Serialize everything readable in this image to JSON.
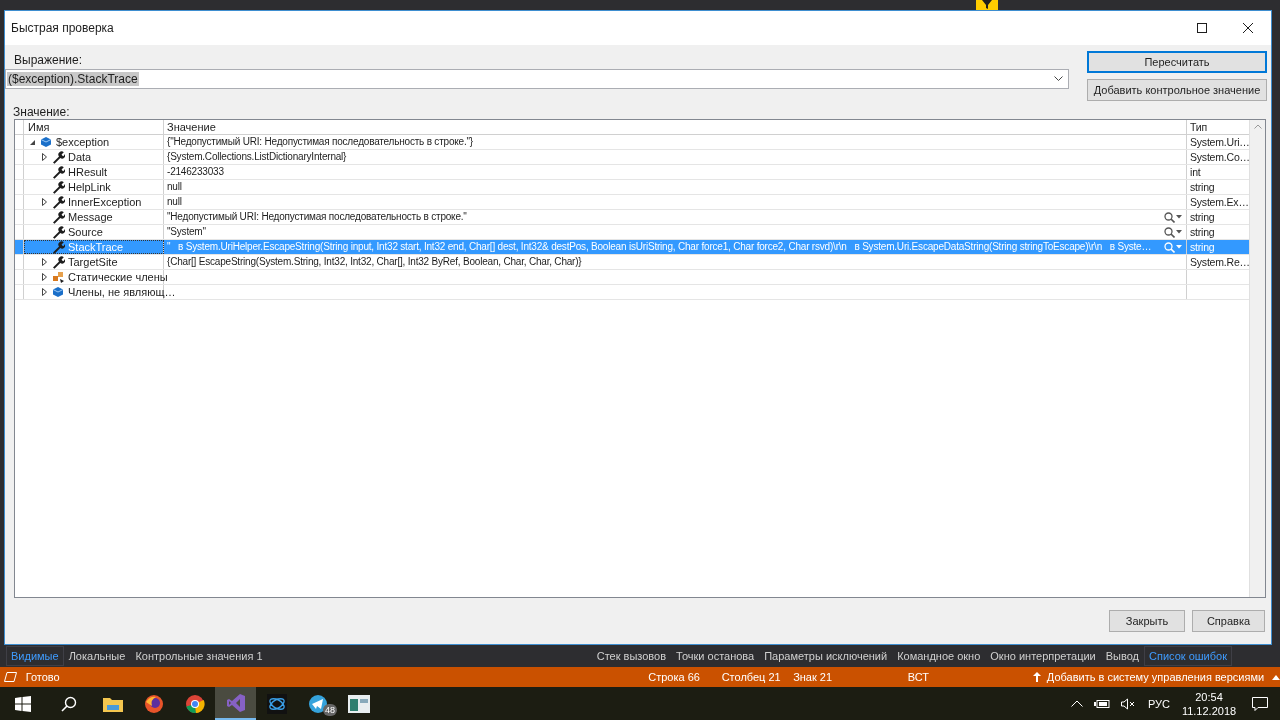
{
  "window": {
    "title": "Быстрая проверка"
  },
  "expression": {
    "label": "Выражение:",
    "value": "($exception).StackTrace"
  },
  "side_buttons": [
    {
      "label": "Пересчитать",
      "default": true
    },
    {
      "label": "Добавить контрольное значение",
      "default": false
    }
  ],
  "value_label": "Значение:",
  "grid": {
    "columns": [
      "Имя",
      "Значение",
      "Тип"
    ],
    "rows": [
      {
        "name": "$exception",
        "value": "{\"Недопустимый URI: Недопустимая последовательность в строке.\"}",
        "type": "System.Uri…",
        "kind": "object",
        "expandable": true,
        "expanded": true,
        "selected": false,
        "children": [
          {
            "name": "Data",
            "value": "{System.Collections.ListDictionaryInternal}",
            "type": "System.Co…",
            "kind": "property",
            "expandable": true,
            "expanded": false,
            "selected": false
          },
          {
            "name": "HResult",
            "value": "-2146233033",
            "type": "int",
            "kind": "property",
            "expandable": false,
            "selected": false
          },
          {
            "name": "HelpLink",
            "value": "null",
            "type": "string",
            "kind": "property",
            "expandable": false,
            "selected": false
          },
          {
            "name": "InnerException",
            "value": "null",
            "type": "System.Ex…",
            "kind": "property",
            "expandable": true,
            "expanded": false,
            "selected": false
          },
          {
            "name": "Message",
            "value": "\"Недопустимый URI: Недопустимая последовательность в строке.\"",
            "type": "string",
            "kind": "property",
            "expandable": false,
            "selected": false,
            "visualizer": true
          },
          {
            "name": "Source",
            "value": "\"System\"",
            "type": "string",
            "kind": "property",
            "expandable": false,
            "selected": false,
            "visualizer": true
          },
          {
            "name": "StackTrace",
            "value": "\"   в System.UriHelper.EscapeString(String input, Int32 start, Int32 end, Char[] dest, Int32& destPos, Boolean isUriString, Char force1, Char force2, Char rsvd)\\r\\n   в System.Uri.EscapeDataString(String stringToEscape)\\r\\n   в Syste…",
            "type": "string",
            "kind": "property",
            "expandable": false,
            "selected": true,
            "visualizer": true
          },
          {
            "name": "TargetSite",
            "value": "{Char[] EscapeString(System.String, Int32, Int32, Char[], Int32 ByRef, Boolean, Char, Char, Char)}",
            "type": "System.Re…",
            "kind": "property",
            "expandable": true,
            "expanded": false,
            "selected": false
          },
          {
            "name": "Статические члены",
            "kind": "static",
            "expandable": true,
            "expanded": false,
            "selected": false
          },
          {
            "name": "Члены, не являющ…",
            "kind": "object",
            "expandable": true,
            "expanded": false,
            "selected": false
          }
        ]
      }
    ]
  },
  "dialog_buttons": [
    "Закрыть",
    "Справка"
  ],
  "tool_tabs_left": [
    {
      "label": "Видимые",
      "selected": true
    },
    {
      "label": "Локальные",
      "selected": false
    },
    {
      "label": "Контрольные значения 1",
      "selected": false
    }
  ],
  "tool_tabs_right": [
    {
      "label": "Стек вызовов",
      "selected": false
    },
    {
      "label": "Точки останова",
      "selected": false
    },
    {
      "label": "Параметры исключений",
      "selected": false
    },
    {
      "label": "Командное окно",
      "selected": false
    },
    {
      "label": "Окно интерпретации",
      "selected": false
    },
    {
      "label": "Вывод",
      "selected": false
    },
    {
      "label": "Список ошибок",
      "selected": true
    }
  ],
  "status_bar": {
    "text": "Готово",
    "line": "Строка 66",
    "column": "Столбец 21",
    "char": "Знак 21",
    "mode": "ВСТ",
    "source_control": "Добавить в систему управления версиями"
  },
  "taskbar": {
    "apps": [
      {
        "kind": "explorer",
        "active": false
      },
      {
        "kind": "firefox",
        "active": false
      },
      {
        "kind": "chrome",
        "active": false
      },
      {
        "kind": "visualstudio",
        "active": true
      },
      {
        "kind": "dark",
        "active": false
      },
      {
        "kind": "telegram",
        "active": false,
        "badge": "48"
      },
      {
        "kind": "window",
        "active": false
      }
    ],
    "language": "РУС",
    "time": "20:54",
    "date": "11.12.2018"
  }
}
